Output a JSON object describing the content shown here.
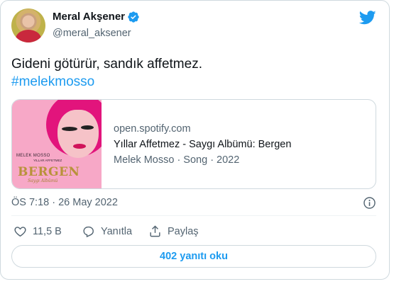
{
  "author": {
    "name": "Meral Akşener",
    "handle": "@meral_aksener",
    "verified": true
  },
  "tweet": {
    "text": "Gideni götürür, sandık affetmez.",
    "hashtag": "#melekmosso"
  },
  "link_card": {
    "domain": "open.spotify.com",
    "title": "Yıllar Affetmez - Saygı Albümü: Bergen",
    "description": "Melek Mosso · Song · 2022",
    "cover": {
      "artist": "MELEK MOSSO",
      "subtitle": "YILLAR AFFETMEZ",
      "album": "BERGEN",
      "script": "Saygı Albümü"
    }
  },
  "timestamp": "ÖS 7:18 · 26 May 2022",
  "actions": {
    "like_count": "11,5 B",
    "reply_label": "Yanıtla",
    "share_label": "Paylaş"
  },
  "replies_button": "402 yanıtı oku",
  "colors": {
    "accent": "#1d9bf0",
    "text": "#0f1419",
    "secondary": "#536471",
    "border": "#cfd9de"
  },
  "icons": [
    "verified-badge-icon",
    "twitter-bird-icon",
    "info-icon",
    "heart-icon",
    "reply-bubble-icon",
    "share-icon"
  ]
}
